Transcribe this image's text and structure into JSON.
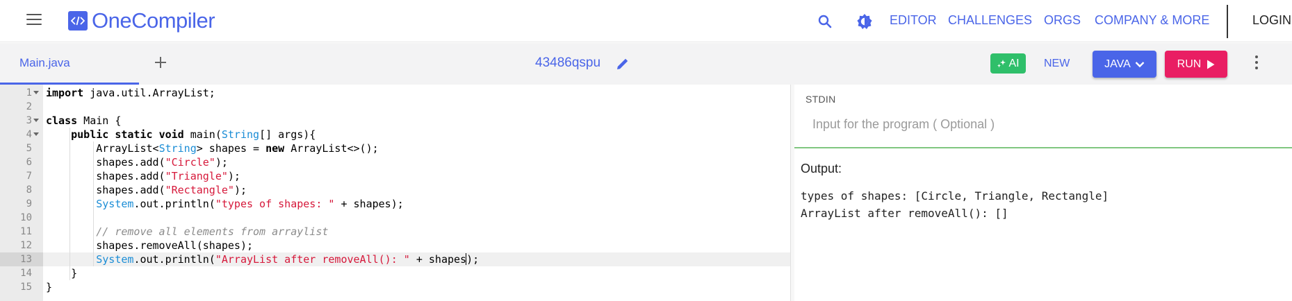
{
  "nav": {
    "brand": "OneCompiler",
    "links": [
      "EDITOR",
      "CHALLENGES",
      "ORGS",
      "COMPANY & MORE"
    ],
    "login": "LOGIN"
  },
  "toolbar": {
    "file_tab": "Main.java",
    "fiddle_id": "43486qspu",
    "ai_label": "AI",
    "new_label": "NEW",
    "language": "JAVA",
    "run_label": "RUN"
  },
  "editor": {
    "active_line": 13,
    "lines": [
      {
        "n": "1",
        "text": "import java.util.ArrayList;"
      },
      {
        "n": "2",
        "text": ""
      },
      {
        "n": "3",
        "text": "class Main {"
      },
      {
        "n": "4",
        "text": "    public static void main(String[] args){"
      },
      {
        "n": "5",
        "text": "        ArrayList<String> shapes = new ArrayList<>();"
      },
      {
        "n": "6",
        "text": "        shapes.add(\"Circle\");"
      },
      {
        "n": "7",
        "text": "        shapes.add(\"Triangle\");"
      },
      {
        "n": "8",
        "text": "        shapes.add(\"Rectangle\");"
      },
      {
        "n": "9",
        "text": "        System.out.println(\"types of shapes: \" + shapes);"
      },
      {
        "n": "10",
        "text": ""
      },
      {
        "n": "11",
        "text": "        // remove all elements from arraylist"
      },
      {
        "n": "12",
        "text": "        shapes.removeAll(shapes);"
      },
      {
        "n": "13",
        "text": "        System.out.println(\"ArrayList after removeAll(): \" + shapes);"
      },
      {
        "n": "14",
        "text": "    }"
      },
      {
        "n": "15",
        "text": "}"
      }
    ]
  },
  "stdin": {
    "label": "STDIN",
    "placeholder": "Input for the program ( Optional )"
  },
  "output": {
    "label": "Output:",
    "lines": [
      "types of shapes: [Circle, Triangle, Rectangle]",
      "ArrayList after removeAll(): []"
    ]
  },
  "colors": {
    "brand": "#4a65e8",
    "run": "#e91e63",
    "ai": "#2fbf6a",
    "keyword_type": "#1b8dd6",
    "string": "#d6183a"
  },
  "icons": [
    "menu-icon",
    "code-logo-icon",
    "search-icon",
    "theme-toggle-icon",
    "plus-icon",
    "pencil-icon",
    "sparkle-icon",
    "chevron-down-icon",
    "play-icon",
    "more-vertical-icon"
  ]
}
